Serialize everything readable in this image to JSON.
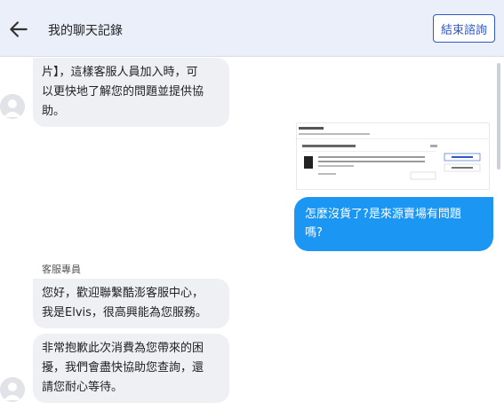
{
  "header": {
    "title": "我的聊天記錄",
    "end_button_label": "結束諮詢"
  },
  "messages": [
    {
      "from": "agent",
      "text": "片】，這樣客服人員加入時，可\n以更快地了解您的問題並提供協\n助。"
    },
    {
      "from": "user",
      "type": "image",
      "text": ""
    },
    {
      "from": "user",
      "text": "怎麼沒貨了?是來源賣場有問題\n嗎?"
    },
    {
      "from": "agent",
      "sender": "客服專員",
      "text": "您好，歡迎聯繫酷澎客服中心，\n我是Elvis，很高興能為您服務。"
    },
    {
      "from": "agent",
      "text": "非常抱歉此次消費為您帶來的困\n擾，我們會盡快協助您查詢，還\n請您耐心等待。"
    }
  ]
}
